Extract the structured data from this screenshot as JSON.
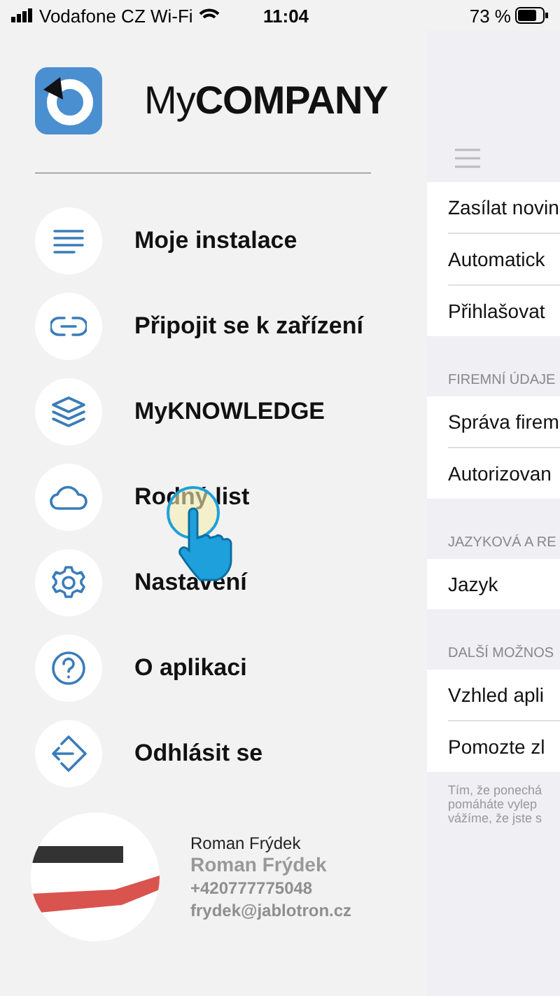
{
  "status_bar": {
    "carrier": "Vodafone CZ Wi-Fi",
    "time": "11:04",
    "battery": "73 %"
  },
  "brand": {
    "light": "My",
    "bold": "COMPANY"
  },
  "menu": [
    {
      "label": "Moje instalace",
      "kind": "list"
    },
    {
      "label": "Připojit se k zařízení",
      "kind": "link"
    },
    {
      "label": "MyKNOWLEDGE",
      "kind": "layers"
    },
    {
      "label": "Rodný list",
      "kind": "cloud"
    },
    {
      "label": "Nastavení",
      "kind": "gear"
    },
    {
      "label": "O aplikaci",
      "kind": "help"
    },
    {
      "label": "Odhlásit se",
      "kind": "logout"
    }
  ],
  "profile": {
    "title": "Roman Frýdek",
    "name": "Roman Frýdek",
    "phone": "+420777775048",
    "email": "frydek@jablotron.cz"
  },
  "settings": {
    "groups": [
      {
        "rows": [
          "Zasílat novin",
          "Automatick",
          "Přihlašovat"
        ]
      },
      {
        "header": "FIREMNÍ ÚDAJE",
        "rows": [
          "Správa firem",
          "Autorizovan"
        ]
      },
      {
        "header": "JAZYKOVÁ A RE",
        "rows": [
          "Jazyk"
        ]
      },
      {
        "header": "DALŠÍ MOŽNOS",
        "rows": [
          "Vzhled apli",
          "Pomozte zl"
        ]
      }
    ],
    "footer": [
      "Tím, že ponechá",
      "pomáháte vylep",
      "vážíme, že jste s"
    ]
  }
}
